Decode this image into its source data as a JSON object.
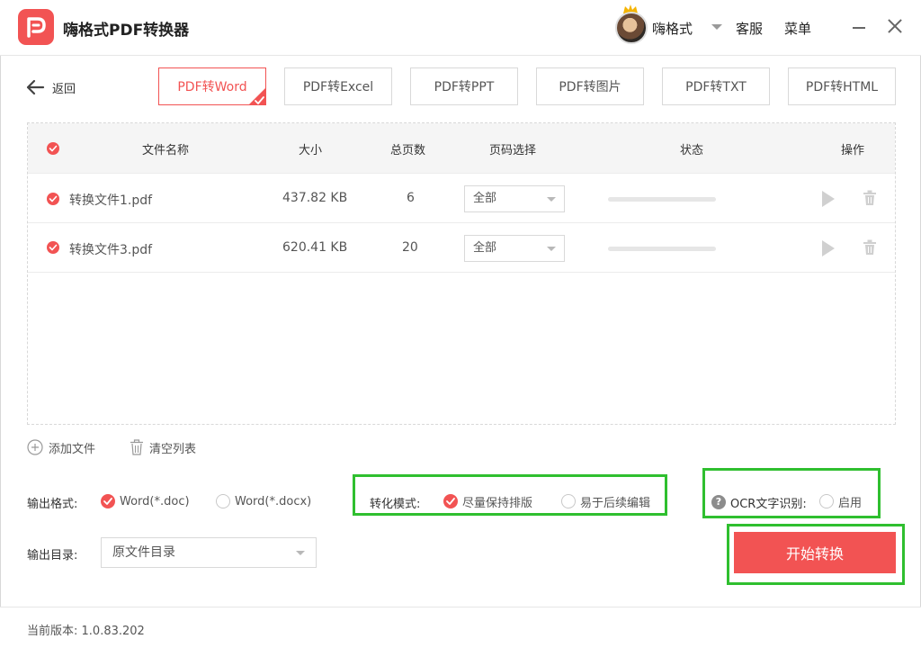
{
  "app": {
    "title": "嗨格式PDF转换器"
  },
  "header": {
    "username": "嗨格式",
    "service": "客服",
    "menu": "菜单"
  },
  "nav": {
    "back_label": "返回"
  },
  "tabs": [
    {
      "label": "PDF转Word",
      "active": true
    },
    {
      "label": "PDF转Excel",
      "active": false
    },
    {
      "label": "PDF转PPT",
      "active": false
    },
    {
      "label": "PDF转图片",
      "active": false
    },
    {
      "label": "PDF转TXT",
      "active": false
    },
    {
      "label": "PDF转HTML",
      "active": false
    }
  ],
  "table": {
    "columns": {
      "name": "文件名称",
      "size": "大小",
      "pages": "总页数",
      "page_select": "页码选择",
      "status": "状态",
      "actions": "操作"
    },
    "rows": [
      {
        "name": "转换文件1.pdf",
        "size": "437.82 KB",
        "pages": "6",
        "page_select": "全部",
        "progress": 0
      },
      {
        "name": "转换文件3.pdf",
        "size": "620.41 KB",
        "pages": "20",
        "page_select": "全部",
        "progress": 0
      }
    ]
  },
  "actions": {
    "add_file": "添加文件",
    "clear_list": "清空列表"
  },
  "output_format": {
    "label": "输出格式:",
    "options": [
      {
        "label": "Word(*.doc)",
        "selected": true
      },
      {
        "label": "Word(*.docx)",
        "selected": false
      }
    ]
  },
  "convert_mode": {
    "label": "转化模式:",
    "options": [
      {
        "label": "尽量保持排版",
        "selected": true
      },
      {
        "label": "易于后续编辑",
        "selected": false
      }
    ]
  },
  "ocr": {
    "label": "OCR文字识别:",
    "option": "启用",
    "enabled": false
  },
  "output_dir": {
    "label": "输出目录:",
    "value": "原文件目录"
  },
  "start_button": "开始转换",
  "footer": {
    "version_label": "当前版本:",
    "version": "1.0.83.202"
  },
  "colors": {
    "accent": "#f25353",
    "highlight": "#2fbf2f"
  }
}
